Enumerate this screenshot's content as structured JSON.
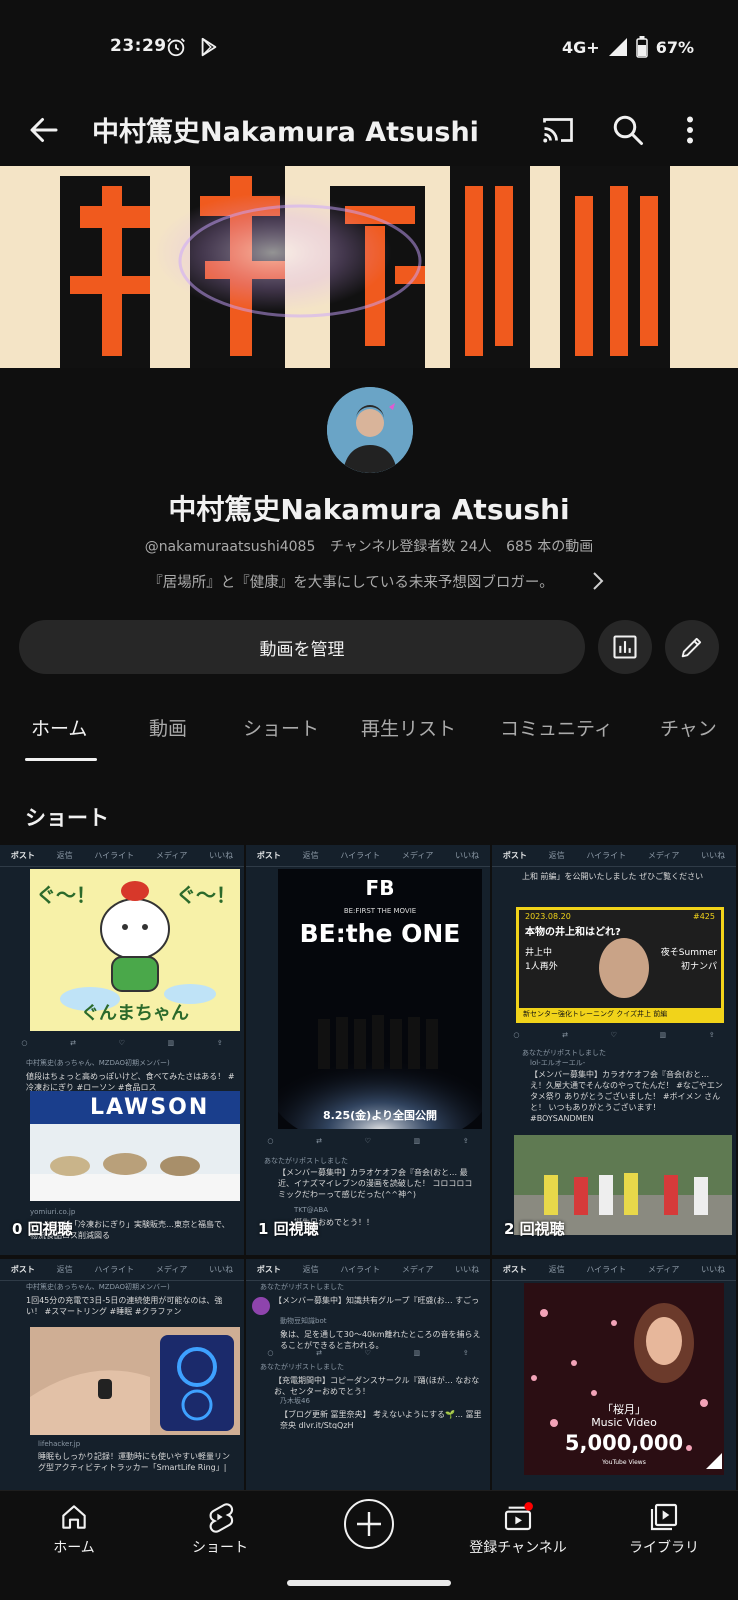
{
  "status_bar": {
    "time": "23:29",
    "network": "4G+",
    "battery": "67%"
  },
  "app_bar": {
    "title": "中村篤史Nakamura Atsushi"
  },
  "channel": {
    "name": "中村篤史Nakamura Atsushi",
    "handle": "@nakamuraatsushi4085",
    "subscribers": "チャンネル登録者数 24人",
    "video_count": "685 本の動画",
    "description": "『居場所』と『健康』を大事にしている未来予想図ブロガー。",
    "manage_button": "動画を管理"
  },
  "tabs": [
    "ホーム",
    "動画",
    "ショート",
    "再生リスト",
    "コミュニティ",
    "チャン"
  ],
  "section_title": "ショート",
  "twitter_tabs": [
    "ポスト",
    "返信",
    "ハイライト",
    "メディア",
    "いいね"
  ],
  "shorts": [
    {
      "views": "0 回視聴",
      "mascot_text_1": "ぐ〜！",
      "mascot_text_2": "ぐ〜！",
      "mascot_caption": "ぐんまちゃん",
      "tweet_author": "中村篤史(あっちゃん、MZDAO初期メンバー)",
      "tweet_text": "値段はちょっと高めっぽいけど、食べてみたさはある！ #冷凍おにぎり #ローソン #食品ロス",
      "store_sign": "LAWSON",
      "link_site": "yomiuri.co.jp",
      "link_text": "ローソンが「冷凍おにぎり」実験販売…東京と福島で、物流食品ロス削減図る"
    },
    {
      "views": "1 回視聴",
      "poster_top": "BE:FIRST THE MOVIE",
      "poster_title": "BE:the ONE",
      "poster_date": "8.25(金)より全国公開",
      "retweet_label": "あなたがリポストしました",
      "tweet_text": "【メンバー募集中】カラオケオフ会『音会(おと… 最近、イナズマイレブンの漫画を読破した！ コロコロコミックだわーって感じだった(^^神^)",
      "tweet2_author": "TKT@ABA",
      "tweet2_text": "誕生日おめでとう！！"
    },
    {
      "views": "2 回視聴",
      "tweet_top": "上和 前編」を公開いたしました ぜひご覧ください",
      "card_date": "2023.08.20",
      "card_number": "#425",
      "card_title": "本物の井上和はどれ?",
      "card_items": [
        "井上中",
        "1人再外",
        "夜そSummer",
        "初ナンパ"
      ],
      "card_footer": "新センター強化トレーニング クイズ井上 前編",
      "retweet_label": "あなたがリポストしました",
      "tweet2_author": "lol-エルオーエル-",
      "tweet2_text": "【メンバー募集中】カラオケオフ会『音会(おと… え！久屋大通でそんなのやってたんだ！ #なごやエンタメ祭り ありがとうございました！ #ボイメン さんと！ いつもありがとうございます！ #BOYSANDMEN"
    },
    {
      "views": "",
      "tweet_author": "中村篤史(あっちゃん、MZDAO初期メンバー)",
      "tweet_text": "1回45分の充電で3日-5日の連続使用が可能なのは、強い！ #スマートリング #睡眠 #クラファン",
      "link_site": "lifehacker.jp",
      "link_text": "睡眠もしっかり記録！運動時にも使いやすい軽量リング型アクティビティトラッカー「SmartLife Ring」| ライフハッカ…"
    },
    {
      "views": "",
      "retweet_label": "あなたがリポストしました",
      "tweet_text": "【メンバー募集中】知識共有グループ『旺盛(お… すごっ",
      "quote_author": "動物豆知識bot",
      "quote_text": "象は、足を通して30〜40km離れたところの音を捕らえることができると言われる。",
      "retweet_label_2": "あなたがリポストしました",
      "tweet2_text": "【充電期間中】コピーダンスサークル『踊(ほが… なおなお、センターおめでとう！",
      "quote2_author": "乃木坂46",
      "quote2_text": "【ブログ更新 冨里奈央】 考えないようにする🌱… 冨里奈央 dlvr.it/StqQzH"
    },
    {
      "views": "",
      "mv_title": "「桜月」",
      "mv_subtitle": "Music Video",
      "mv_count": "5,000,000",
      "mv_badge": "YouTube Views"
    }
  ],
  "bottom_nav": [
    {
      "label": "ホーム",
      "icon": "home-icon"
    },
    {
      "label": "ショート",
      "icon": "shorts-icon"
    },
    {
      "label": "",
      "icon": "create-icon"
    },
    {
      "label": "登録チャンネル",
      "icon": "subscriptions-icon"
    },
    {
      "label": "ライブラリ",
      "icon": "library-icon"
    }
  ],
  "colors": {
    "background": "#0f0f0f",
    "surface": "#272727",
    "text_primary": "#f1f1f1",
    "text_secondary": "#aaaaaa",
    "notification_dot": "#ff0000",
    "banner_orange": "#f05a1e"
  }
}
